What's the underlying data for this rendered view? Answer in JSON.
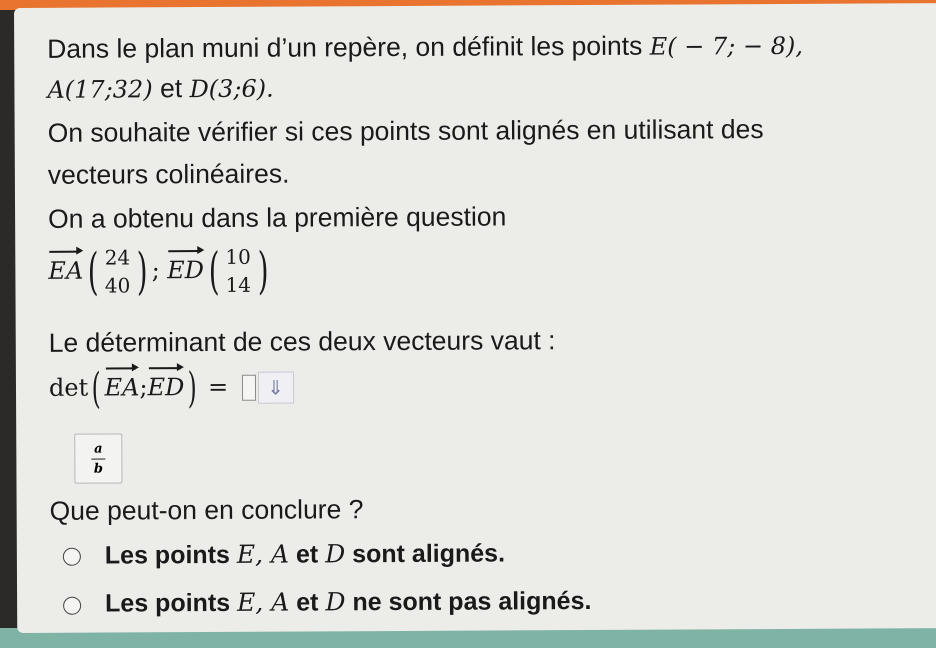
{
  "intro_text": "Dans le plan muni d’un repère, on définit les points",
  "point_E": "E( − 7; − 8),",
  "point_A": "A(17;32)",
  "et_word": "et",
  "point_D": "D(3;6).",
  "goal_line1": "On souhaite vérifier si ces points sont alignés en utilisant des",
  "goal_line2": "vecteurs colinéaires.",
  "first_question_text": "On a obtenu dans la première question",
  "vectors": {
    "ea_name": "EA",
    "ea_x": "24",
    "ea_y": "40",
    "separator": ";",
    "ed_name": "ED",
    "ed_x": "10",
    "ed_y": "14"
  },
  "determinant_text": "Le déterminant de ces deux vecteurs vaut :",
  "det_expression": {
    "det_word": "det",
    "ea": "EA",
    "semicolon": ";",
    "ed": "ED",
    "equals": "="
  },
  "answer_input": {
    "value": ""
  },
  "dropdown_icon": "double-down-arrow-icon",
  "fraction_button": {
    "numerator": "a",
    "denominator": "b"
  },
  "conclusion_question": "Que peut-on en conclure ?",
  "options": [
    {
      "prefix": "Les points",
      "letters": "E, A",
      "et": "et",
      "last": "D",
      "suffix": "sont alignés."
    },
    {
      "prefix": "Les points",
      "letters": "E, A",
      "et": "et",
      "last": "D",
      "suffix": "ne sont pas alignés."
    }
  ]
}
